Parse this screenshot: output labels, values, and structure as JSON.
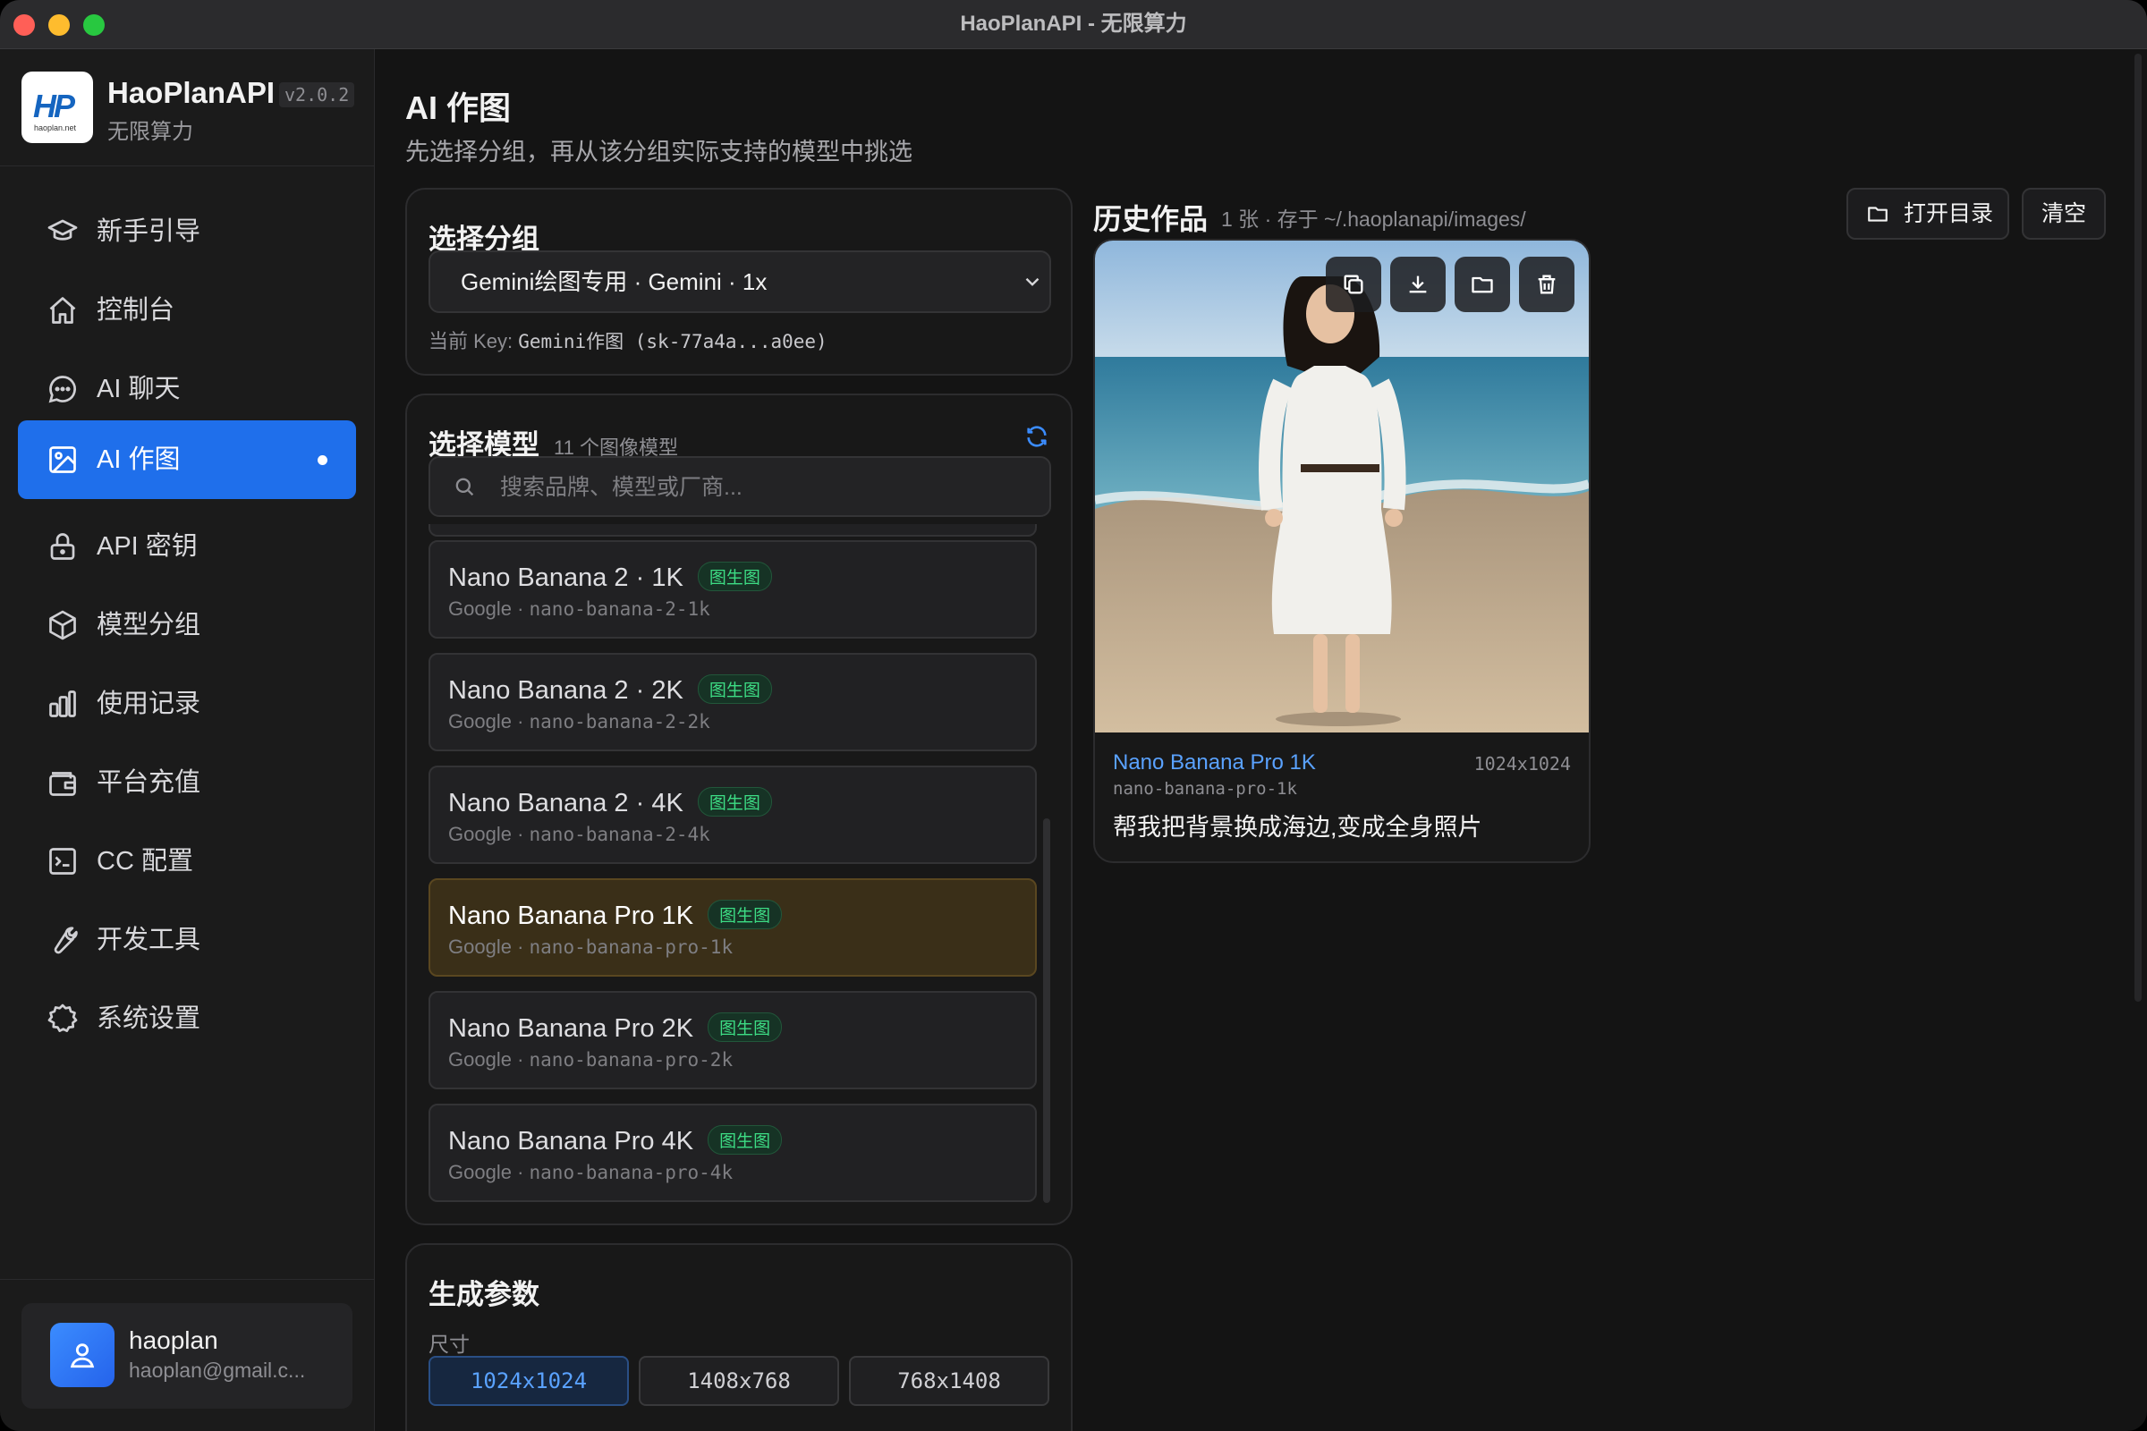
{
  "window": {
    "title": "HaoPlanAPI - 无限算力"
  },
  "brand": {
    "name": "HaoPlanAPI",
    "version": "v2.0.2",
    "subtitle": "无限算力",
    "logo_text": "HP",
    "logo_small": "haoplan.net"
  },
  "sidebar": {
    "items": [
      {
        "label": "新手引导",
        "icon": "graduation-cap-icon"
      },
      {
        "label": "控制台",
        "icon": "home-icon"
      },
      {
        "label": "AI 聊天",
        "icon": "chat-bubble-icon"
      },
      {
        "label": "AI 作图",
        "icon": "image-icon",
        "active": true
      },
      {
        "label": "API 密钥",
        "icon": "lock-icon"
      },
      {
        "label": "模型分组",
        "icon": "cube-icon"
      },
      {
        "label": "使用记录",
        "icon": "bar-chart-icon"
      },
      {
        "label": "平台充值",
        "icon": "wallet-icon"
      },
      {
        "label": "CC 配置",
        "icon": "terminal-icon"
      },
      {
        "label": "开发工具",
        "icon": "wrench-icon"
      },
      {
        "label": "系统设置",
        "icon": "gear-icon"
      }
    ]
  },
  "user": {
    "name": "haoplan",
    "email": "haoplan@gmail.c..."
  },
  "page": {
    "title": "AI 作图",
    "subtitle": "先选择分组，再从该分组实际支持的模型中挑选"
  },
  "group_card": {
    "title": "选择分组",
    "selected": "Gemini绘图专用 · Gemini · 1x",
    "key_label": "当前 Key:",
    "key_value": "Gemini作图 (sk-77a4a...a0ee)"
  },
  "model_card": {
    "title": "选择模型",
    "count": "11 个图像模型",
    "search_placeholder": "搜索品牌、模型或厂商...",
    "models": [
      {
        "name": "Nano Banana 2 · 1K",
        "badge": "图生图",
        "vendor": "Google",
        "id": "nano-banana-2-1k"
      },
      {
        "name": "Nano Banana 2 · 2K",
        "badge": "图生图",
        "vendor": "Google",
        "id": "nano-banana-2-2k"
      },
      {
        "name": "Nano Banana 2 · 4K",
        "badge": "图生图",
        "vendor": "Google",
        "id": "nano-banana-2-4k"
      },
      {
        "name": "Nano Banana Pro 1K",
        "badge": "图生图",
        "vendor": "Google",
        "id": "nano-banana-pro-1k",
        "selected": true
      },
      {
        "name": "Nano Banana Pro 2K",
        "badge": "图生图",
        "vendor": "Google",
        "id": "nano-banana-pro-2k"
      },
      {
        "name": "Nano Banana Pro 4K",
        "badge": "图生图",
        "vendor": "Google",
        "id": "nano-banana-pro-4k"
      }
    ]
  },
  "params_card": {
    "title": "生成参数",
    "size_label": "尺寸",
    "sizes": [
      "1024x1024",
      "1408x768",
      "768x1408"
    ],
    "selected_size": "1024x1024"
  },
  "history": {
    "title": "历史作品",
    "meta": "1 张 · 存于 ~/.haoplanapi/images/",
    "open_dir_label": "打开目录",
    "clear_label": "清空",
    "items": [
      {
        "model": "Nano Banana Pro 1K",
        "dimensions": "1024x1024",
        "model_id": "nano-banana-pro-1k",
        "prompt": "帮我把背景换成海边,变成全身照片"
      }
    ]
  },
  "colors": {
    "accent": "#1f6feb",
    "selected_model_bg": "#3a2f18",
    "badge_green": "#3ddc84",
    "link_blue": "#5aa2ff"
  }
}
